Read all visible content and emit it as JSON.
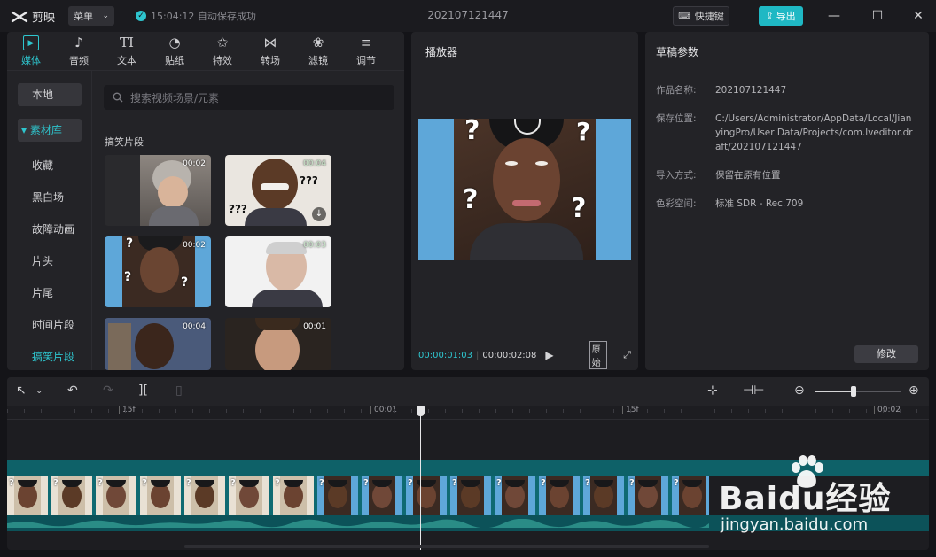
{
  "titlebar": {
    "app_name": "剪映",
    "menu_label": "菜单",
    "autosave_text": "15:04:12 自动保存成功",
    "project_title": "202107121447",
    "shortcut_label": "快捷键",
    "export_label": "导出"
  },
  "media": {
    "tabs": [
      {
        "label": "媒体",
        "icon": "▶"
      },
      {
        "label": "音频",
        "icon": "♪"
      },
      {
        "label": "文本",
        "icon": "TI"
      },
      {
        "label": "贴纸",
        "icon": "◔"
      },
      {
        "label": "特效",
        "icon": "✩"
      },
      {
        "label": "转场",
        "icon": "⋈"
      },
      {
        "label": "滤镜",
        "icon": "❀"
      },
      {
        "label": "调节",
        "icon": "≡"
      }
    ],
    "sidebar": [
      "本地",
      "▾ 素材库",
      "收藏",
      "黑白场",
      "故障动画",
      "片头",
      "片尾",
      "时间片段",
      "搞笑片段"
    ],
    "search_placeholder": "搜索视频场景/元素",
    "section_title": "搞笑片段",
    "clips": [
      {
        "duration": "00:02"
      },
      {
        "duration": "00:04"
      },
      {
        "duration": "00:02"
      },
      {
        "duration": "00:03"
      },
      {
        "duration": "00:04"
      },
      {
        "duration": "00:01"
      }
    ]
  },
  "player": {
    "title": "播放器",
    "current_time": "00:00:01:03",
    "total_time": "00:00:02:08",
    "original_label": "原始"
  },
  "draft": {
    "title": "草稿参数",
    "rows": [
      {
        "label": "作品名称:",
        "value": "202107121447"
      },
      {
        "label": "保存位置:",
        "value": "C:/Users/Administrator/AppData/Local/JianyingPro/User Data/Projects/com.lveditor.draft/202107121447"
      },
      {
        "label": "导入方式:",
        "value": "保留在原有位置"
      },
      {
        "label": "色彩空间:",
        "value": "标准 SDR - Rec.709"
      }
    ],
    "modify_label": "修改"
  },
  "timeline": {
    "ticks": [
      "15f",
      "00:01",
      "15f",
      "00:02"
    ],
    "zoom_level": 0.45
  },
  "watermark": {
    "main": "Baidu经验",
    "sub": "jingyan.baidu.com"
  },
  "colors": {
    "accent": "#2ec5ce",
    "track": "#0f6a72"
  }
}
